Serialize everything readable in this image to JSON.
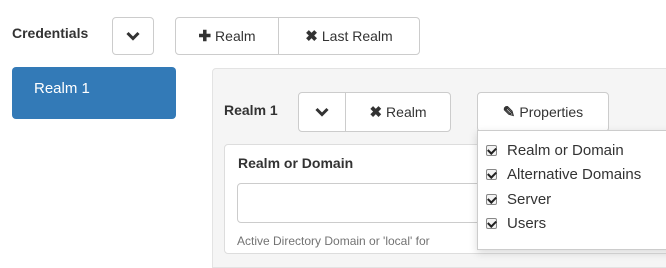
{
  "header": {
    "title": "Credentials",
    "add_realm_label": "Realm",
    "remove_last_realm_label": "Last Realm"
  },
  "sidebar": {
    "items": [
      {
        "label": "Realm 1",
        "active": true
      }
    ]
  },
  "realm_panel": {
    "title": "Realm 1",
    "remove_realm_label": "Realm",
    "properties_label": "Properties",
    "field": {
      "label": "Realm or Domain",
      "value": "",
      "help_text": "Active Directory Domain or 'local' for"
    }
  },
  "properties_menu": {
    "items": [
      {
        "label": "Realm or Domain",
        "checked": true
      },
      {
        "label": "Alternative Domains",
        "checked": true
      },
      {
        "label": "Server",
        "checked": true
      },
      {
        "label": "Users",
        "checked": true
      }
    ]
  },
  "colors": {
    "accent": "#337ab7",
    "border": "#cccccc",
    "panel_bg": "#f5f5f5"
  }
}
